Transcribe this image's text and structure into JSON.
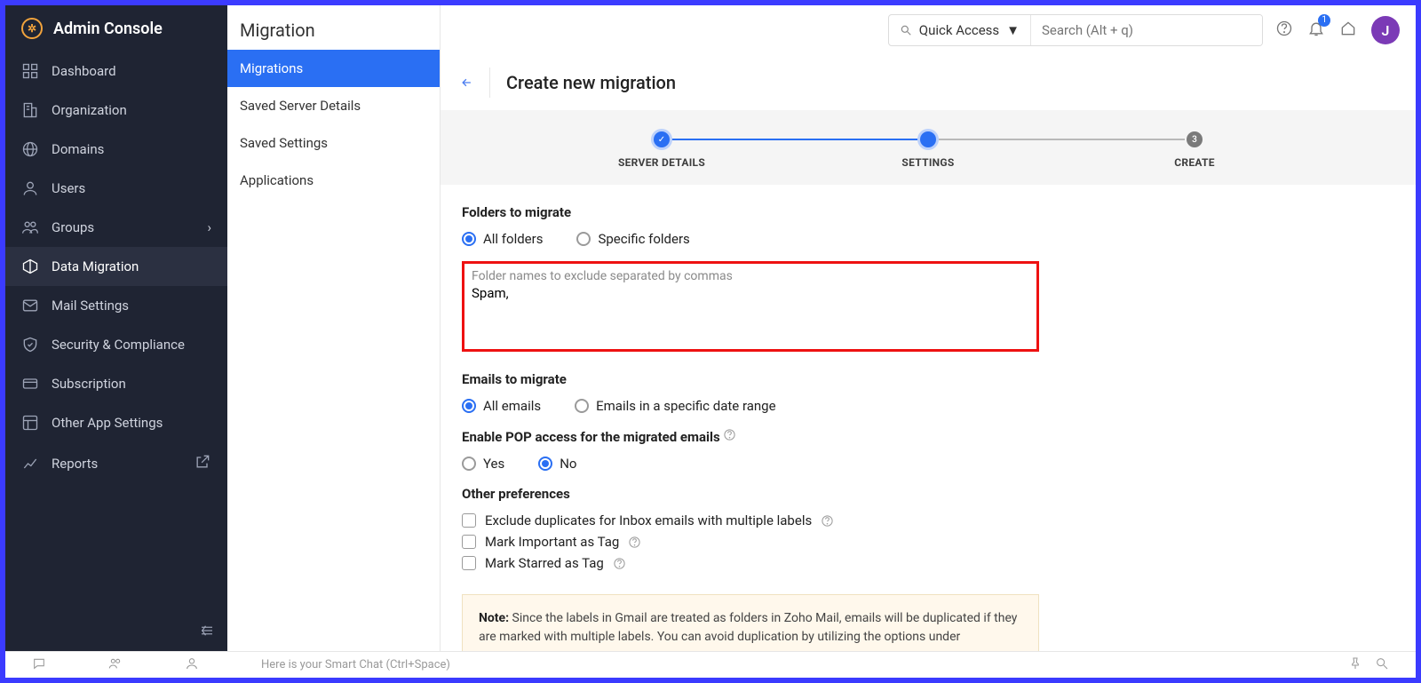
{
  "brand": "Admin Console",
  "sidebar": {
    "items": [
      {
        "label": "Dashboard"
      },
      {
        "label": "Organization"
      },
      {
        "label": "Domains"
      },
      {
        "label": "Users"
      },
      {
        "label": "Groups"
      },
      {
        "label": "Data Migration"
      },
      {
        "label": "Mail Settings"
      },
      {
        "label": "Security & Compliance"
      },
      {
        "label": "Subscription"
      },
      {
        "label": "Other App Settings"
      },
      {
        "label": "Reports"
      }
    ]
  },
  "subpanel": {
    "title": "Migration",
    "items": [
      {
        "label": "Migrations"
      },
      {
        "label": "Saved Server Details"
      },
      {
        "label": "Saved Settings"
      },
      {
        "label": "Applications"
      }
    ]
  },
  "topbar": {
    "quick_access": "Quick Access",
    "search_placeholder": "Search (Alt + q)",
    "badge": "1",
    "avatar": "J"
  },
  "page": {
    "title": "Create new migration",
    "steps": [
      "SERVER DETAILS",
      "SETTINGS",
      "CREATE"
    ],
    "step3_num": "3"
  },
  "form": {
    "folders_title": "Folders to migrate",
    "all_folders": "All folders",
    "specific_folders": "Specific folders",
    "exclude_hint": "Folder names to exclude separated by commas",
    "exclude_value": "Spam,",
    "emails_title": "Emails to migrate",
    "all_emails": "All emails",
    "emails_range": "Emails in a specific date range",
    "pop_title": "Enable POP access for the migrated emails",
    "yes": "Yes",
    "no": "No",
    "other_title": "Other preferences",
    "chk1": "Exclude duplicates for Inbox emails with multiple labels",
    "chk2": "Mark Important as Tag",
    "chk3": "Mark Starred as Tag",
    "note_label": "Note:",
    "note_text": " Since the labels in Gmail are treated as folders in Zoho Mail, emails will be duplicated if they are marked with multiple labels. You can avoid duplication by utilizing the options under"
  },
  "footer": {
    "chat_placeholder": "Here is your Smart Chat (Ctrl+Space)"
  }
}
